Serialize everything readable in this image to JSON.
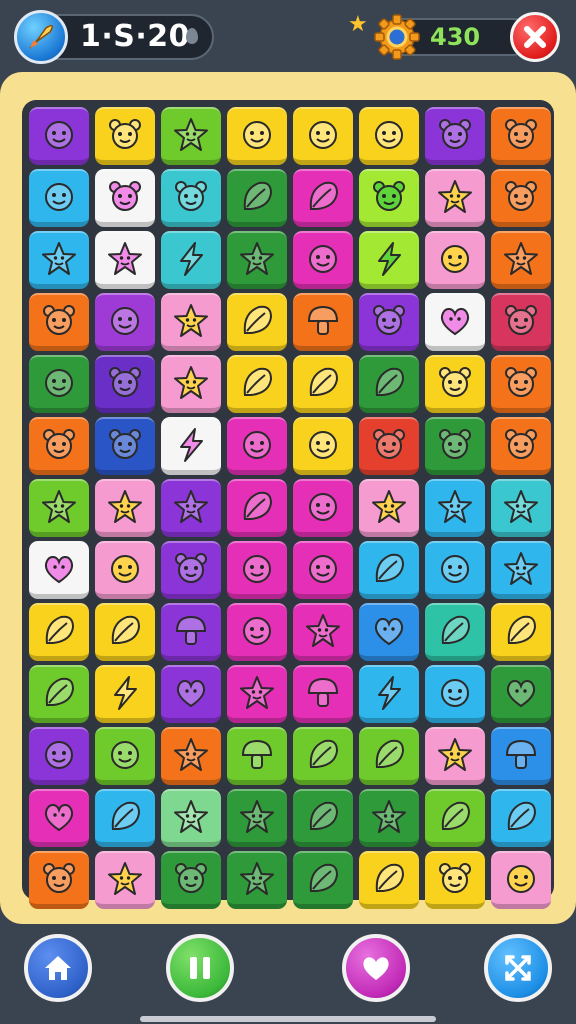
{
  "hud": {
    "level": "1·S·20",
    "score": "430",
    "rocket_button": "rocket-icon",
    "gem_indicator": "gem-icon",
    "gear_badge": "gear-icon",
    "close_button": "close-icon",
    "star_decoration": "star-icon"
  },
  "bottom_nav": [
    {
      "id": "home",
      "icon": "home-icon",
      "color": "#2f62c9"
    },
    {
      "id": "pause",
      "icon": "pause-icon",
      "color": "#3cb93a"
    },
    {
      "id": "favorite",
      "icon": "heart-icon",
      "color": "#c12ab7"
    },
    {
      "id": "shuffle",
      "icon": "shuffle-icon",
      "color": "#1d8fe6"
    }
  ],
  "board": {
    "columns": 8,
    "palette": {
      "purple": "#8b34d8",
      "yellow": "#f8d21c",
      "green": "#6fcb2c",
      "lime": "#a3e832",
      "orange": "#f4731a",
      "blue": "#2c8fe8",
      "sky": "#2fb6ec",
      "cyan": "#3ac7cf",
      "teal": "#2ec3a6",
      "pink": "#f59bd0",
      "magenta": "#e52fb6",
      "white": "#f6f6f6",
      "dkgreen": "#2f9a3a",
      "dkblue": "#2a55c7",
      "dkpurple": "#6a2fc6",
      "red": "#e5402e",
      "rose": "#d8355e",
      "mint": "#7fd88f",
      "gold": "#f6b52a",
      "grape": "#9e3bd6"
    },
    "rows": [
      [
        [
          "purple",
          "face"
        ],
        [
          "yellow",
          "bear"
        ],
        [
          "green",
          "star"
        ],
        [
          "yellow",
          "face"
        ],
        [
          "yellow",
          "face"
        ],
        [
          "yellow",
          "face"
        ],
        [
          "purple",
          "bear"
        ],
        [
          "orange",
          "bear"
        ]
      ],
      [
        [
          "sky",
          "face"
        ],
        [
          "white",
          "bear"
        ],
        [
          "cyan",
          "bear"
        ],
        [
          "dkgreen",
          "leaf"
        ],
        [
          "magenta",
          "leaf"
        ],
        [
          "lime",
          "bear"
        ],
        [
          "pink",
          "star"
        ],
        [
          "orange",
          "bear"
        ]
      ],
      [
        [
          "sky",
          "star"
        ],
        [
          "white",
          "star"
        ],
        [
          "cyan",
          "bolt"
        ],
        [
          "dkgreen",
          "star"
        ],
        [
          "magenta",
          "face"
        ],
        [
          "lime",
          "bolt"
        ],
        [
          "pink",
          "face"
        ],
        [
          "orange",
          "star"
        ]
      ],
      [
        [
          "orange",
          "bear"
        ],
        [
          "grape",
          "face"
        ],
        [
          "pink",
          "star"
        ],
        [
          "yellow",
          "leaf"
        ],
        [
          "orange",
          "mushroom"
        ],
        [
          "purple",
          "bear"
        ],
        [
          "white",
          "heart"
        ],
        [
          "rose",
          "bear"
        ]
      ],
      [
        [
          "dkgreen",
          "face"
        ],
        [
          "dkpurple",
          "bear"
        ],
        [
          "pink",
          "star"
        ],
        [
          "yellow",
          "leaf"
        ],
        [
          "yellow",
          "leaf"
        ],
        [
          "dkgreen",
          "leaf"
        ],
        [
          "yellow",
          "bear"
        ],
        [
          "orange",
          "bear"
        ]
      ],
      [
        [
          "orange",
          "bear"
        ],
        [
          "dkblue",
          "bear"
        ],
        [
          "white",
          "bolt"
        ],
        [
          "magenta",
          "face"
        ],
        [
          "yellow",
          "face"
        ],
        [
          "red",
          "bear"
        ],
        [
          "dkgreen",
          "bear"
        ],
        [
          "orange",
          "bear"
        ]
      ],
      [
        [
          "green",
          "star"
        ],
        [
          "pink",
          "star"
        ],
        [
          "purple",
          "star"
        ],
        [
          "magenta",
          "leaf"
        ],
        [
          "magenta",
          "face"
        ],
        [
          "pink",
          "star"
        ],
        [
          "sky",
          "star"
        ],
        [
          "cyan",
          "star"
        ]
      ],
      [
        [
          "white",
          "heart"
        ],
        [
          "pink",
          "face"
        ],
        [
          "purple",
          "bear"
        ],
        [
          "magenta",
          "face"
        ],
        [
          "magenta",
          "face"
        ],
        [
          "sky",
          "leaf"
        ],
        [
          "sky",
          "face"
        ],
        [
          "sky",
          "star"
        ]
      ],
      [
        [
          "yellow",
          "leaf"
        ],
        [
          "yellow",
          "leaf"
        ],
        [
          "purple",
          "mushroom"
        ],
        [
          "magenta",
          "face"
        ],
        [
          "magenta",
          "star"
        ],
        [
          "blue",
          "heart"
        ],
        [
          "teal",
          "leaf"
        ],
        [
          "yellow",
          "leaf"
        ]
      ],
      [
        [
          "green",
          "leaf"
        ],
        [
          "yellow",
          "bolt"
        ],
        [
          "purple",
          "heart"
        ],
        [
          "magenta",
          "star"
        ],
        [
          "magenta",
          "mushroom"
        ],
        [
          "sky",
          "bolt"
        ],
        [
          "sky",
          "face"
        ],
        [
          "dkgreen",
          "heart"
        ]
      ],
      [
        [
          "purple",
          "face"
        ],
        [
          "green",
          "face"
        ],
        [
          "orange",
          "star"
        ],
        [
          "green",
          "mushroom"
        ],
        [
          "green",
          "leaf"
        ],
        [
          "green",
          "leaf"
        ],
        [
          "pink",
          "star"
        ],
        [
          "blue",
          "mushroom"
        ]
      ],
      [
        [
          "magenta",
          "heart"
        ],
        [
          "sky",
          "leaf"
        ],
        [
          "mint",
          "star"
        ],
        [
          "dkgreen",
          "star"
        ],
        [
          "dkgreen",
          "leaf"
        ],
        [
          "dkgreen",
          "star"
        ],
        [
          "green",
          "leaf"
        ],
        [
          "sky",
          "leaf"
        ]
      ],
      [
        [
          "orange",
          "bear"
        ],
        [
          "pink",
          "star"
        ],
        [
          "dkgreen",
          "bear"
        ],
        [
          "dkgreen",
          "star"
        ],
        [
          "dkgreen",
          "leaf"
        ],
        [
          "yellow",
          "leaf"
        ],
        [
          "yellow",
          "bear"
        ],
        [
          "pink",
          "face"
        ]
      ]
    ]
  }
}
